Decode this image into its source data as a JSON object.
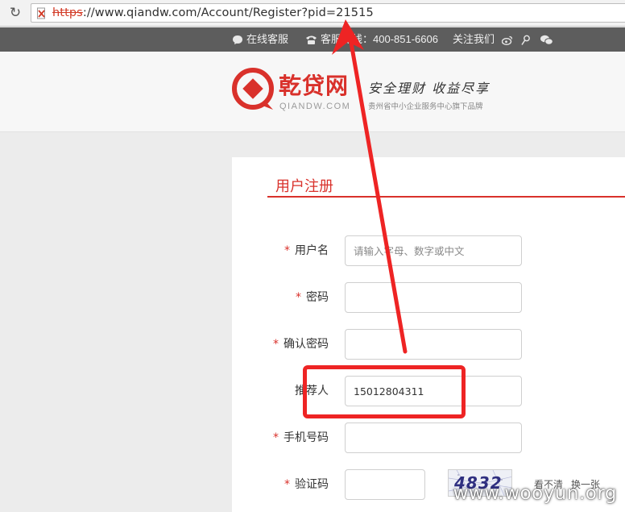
{
  "browser": {
    "url_protocol": "https",
    "url_rest": "://www.qiandw.com/Account/Register?pid=21515",
    "reload_icon": "reload-icon",
    "security_icon": "insecure-lock-icon"
  },
  "topbar": {
    "online_service": "在线客服",
    "hotline": "客服热线：400-851-6606",
    "follow_us": "关注我们",
    "social_icons": [
      "weibo-icon",
      "tencent-weibo-icon",
      "wechat-icon"
    ]
  },
  "header": {
    "logo_cn": "乾贷网",
    "logo_en": "QIANDW.COM",
    "slogan": "安全理财 收益尽享",
    "sub_slogan": "贵州省中小企业服务中心旗下品牌"
  },
  "form": {
    "title": "用户注册",
    "required_mark": "*",
    "username_label": "用户名",
    "username_placeholder": "请输入字母、数字或中文",
    "password_label": "密码",
    "confirm_label": "确认密码",
    "referrer_label": "推荐人",
    "referrer_value": "15012804311",
    "phone_label": "手机号码",
    "captcha_label": "验证码",
    "captcha_text": "4832",
    "cant_see": "看不清",
    "refresh": "换一张"
  },
  "watermark": "www.wooyun.org",
  "colors": {
    "brand_red": "#d9312b",
    "annotation_red": "#ee2424",
    "topbar_bg": "#5d5d5d"
  }
}
